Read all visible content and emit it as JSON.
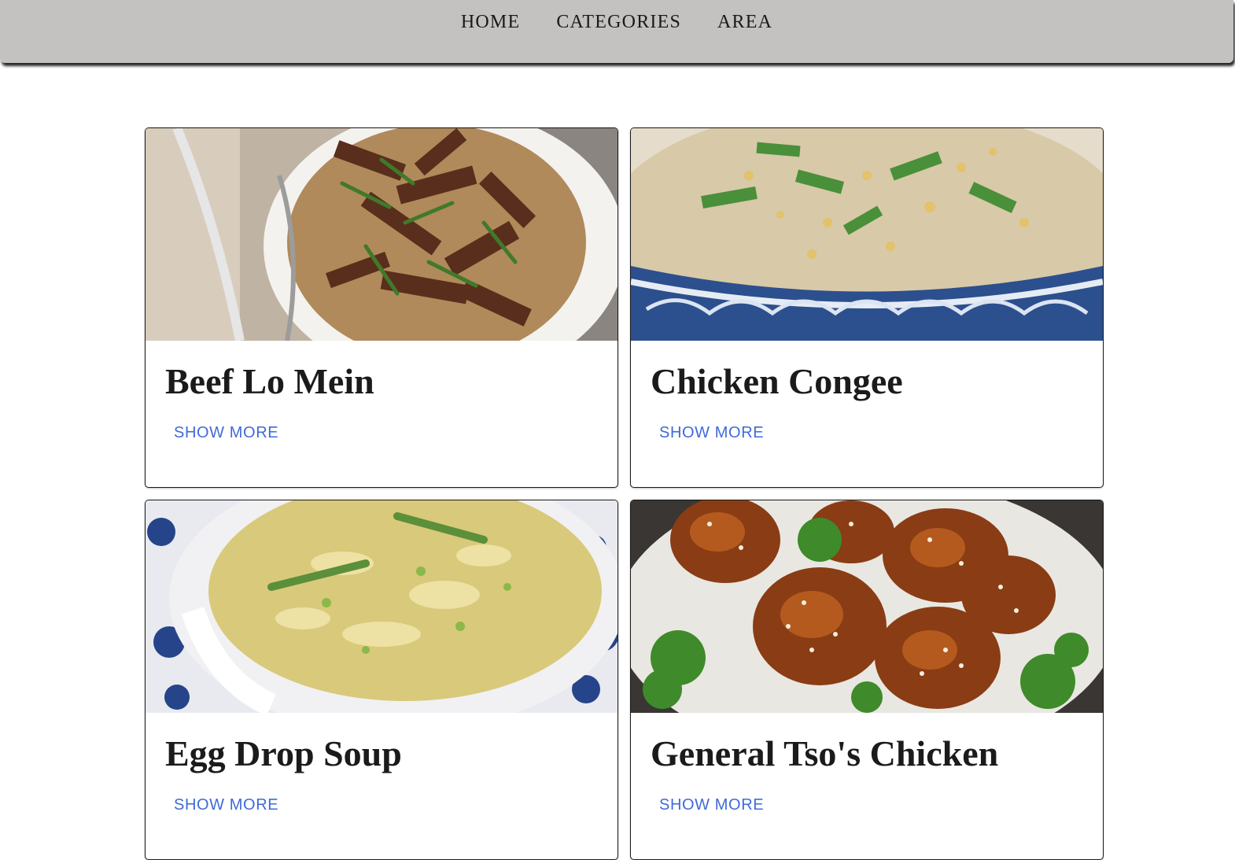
{
  "nav": {
    "home": "HOME",
    "categories": "CATEGORIES",
    "area": "AREA"
  },
  "cards": [
    {
      "title": "Beef Lo Mein",
      "action": "SHOW MORE",
      "image": "beef-lo-mein-photo"
    },
    {
      "title": "Chicken Congee",
      "action": "SHOW MORE",
      "image": "chicken-congee-photo"
    },
    {
      "title": "Egg Drop Soup",
      "action": "SHOW MORE",
      "image": "egg-drop-soup-photo"
    },
    {
      "title": "General Tso's Chicken",
      "action": "SHOW MORE",
      "image": "general-tsos-chicken-photo"
    }
  ],
  "colors": {
    "navbar": "#c4c1c1",
    "link": "#3f6ad8",
    "title": "#1b1b1b"
  }
}
